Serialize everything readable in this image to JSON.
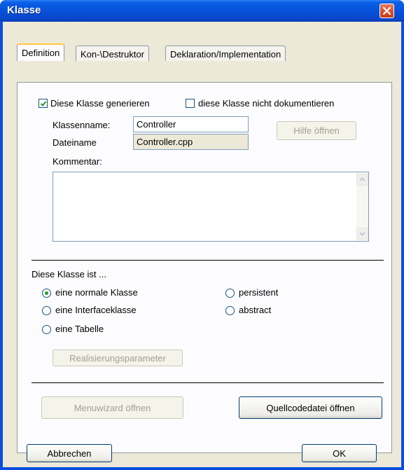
{
  "window": {
    "title": "Klasse"
  },
  "tabs": [
    {
      "label": "Definition",
      "active": true
    },
    {
      "label": "Kon-\\Destruktor",
      "active": false
    },
    {
      "label": "Deklaration/Implementation",
      "active": false
    }
  ],
  "definition": {
    "generate_checkbox": {
      "label": "Diese Klasse generieren",
      "checked": true
    },
    "nodoc_checkbox": {
      "label": "diese Klasse nicht dokumentieren",
      "checked": false
    },
    "classname_label": "Klassenname:",
    "classname_value": "Controller",
    "filename_label": "Dateiname",
    "filename_value": "Controller.cpp",
    "help_button": "Hilfe öffnen",
    "comment_label": "Kommentar:",
    "comment_value": "",
    "class_type_heading": "Diese Klasse ist ...",
    "radio_options": [
      {
        "label": "eine normale Klasse",
        "selected": true
      },
      {
        "label": "eine Interfaceklasse",
        "selected": false
      },
      {
        "label": "eine Tabelle",
        "selected": false
      },
      {
        "label": "persistent",
        "selected": false
      },
      {
        "label": "abstract",
        "selected": false
      }
    ],
    "realization_button": "Realisierungsparameter",
    "menuwizard_button": "Menuwizard öffnen",
    "sourcefile_button": "Quellcodedatei öffnen"
  },
  "footer": {
    "cancel_button": "Abbrechen",
    "ok_button": "OK"
  },
  "colors": {
    "titlebar": "#0750d8",
    "dialog_bg": "#ece9d8",
    "active_tab_accent": "#ffc83c",
    "close_button": "#d8532f"
  }
}
